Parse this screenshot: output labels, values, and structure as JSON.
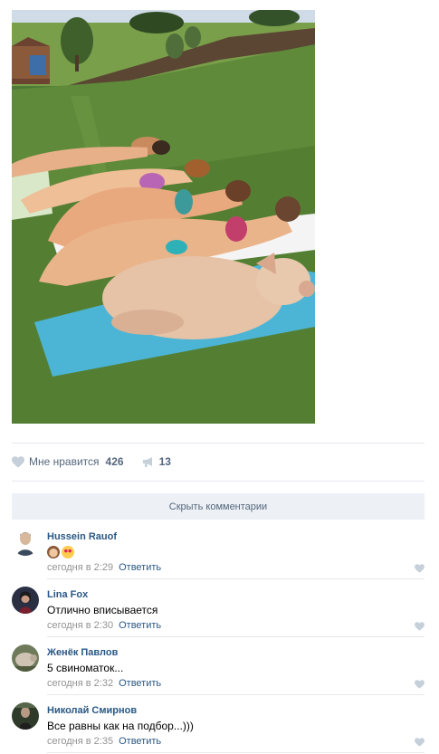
{
  "post": {
    "photo": {
      "alt": ""
    },
    "likes": {
      "label": "Мне нравится",
      "count": "426"
    },
    "shares": {
      "count": "13"
    }
  },
  "comments_toggle": {
    "label": "Скрыть комментарии"
  },
  "comments": [
    {
      "author": "Hussein Rauof",
      "text": "",
      "emojis": [
        "see-no-evil-monkey",
        "heart-eyes"
      ],
      "time": "сегодня в 2:29",
      "reply": "Ответить"
    },
    {
      "author": "Lina Fox",
      "text": "Отлично вписывается",
      "time": "сегодня в 2:30",
      "reply": "Ответить"
    },
    {
      "author": "Женёк Павлов",
      "text": "5 свиноматок...",
      "time": "сегодня в 2:32",
      "reply": "Ответить"
    },
    {
      "author": "Николай Смирнов",
      "text": "Все равны как на подбор...)))",
      "time": "сегодня в 2:35",
      "reply": "Ответить"
    }
  ],
  "colors": {
    "link": "#2a5885",
    "muted": "#939393",
    "accent_bg": "#edf0f5",
    "icon": "#c5d0db"
  }
}
